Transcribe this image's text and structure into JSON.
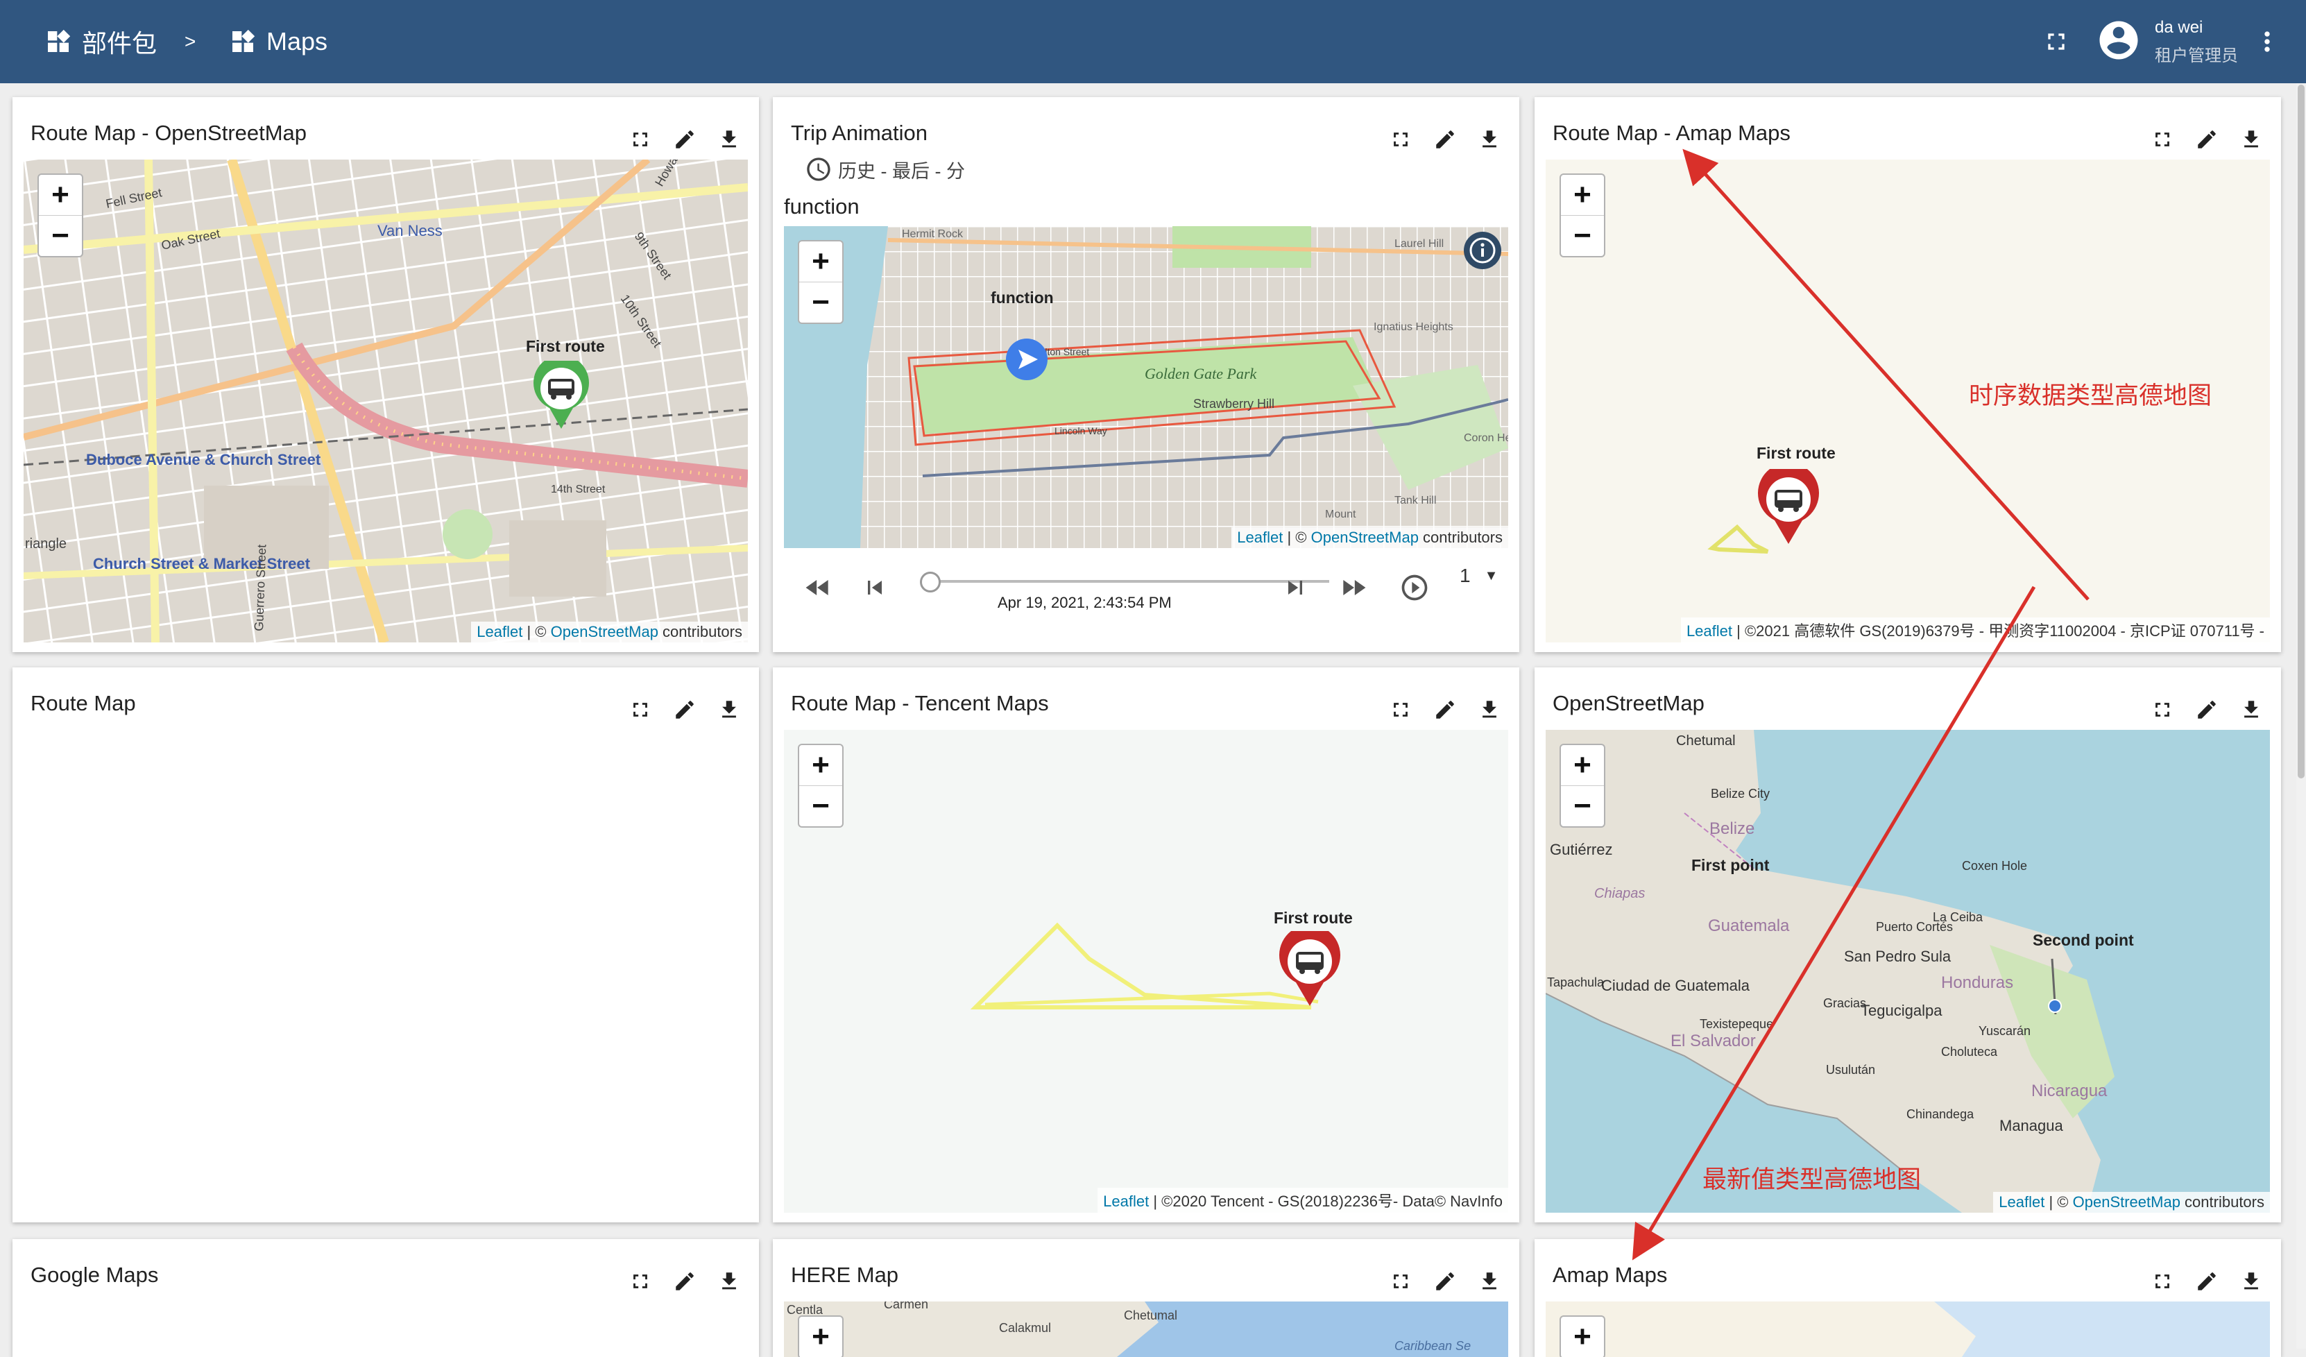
{
  "header": {
    "breadcrumb_parent": "部件包",
    "separator": ">",
    "breadcrumb_current": "Maps",
    "user_name": "da wei",
    "user_role": "租户管理员"
  },
  "widgets": {
    "w1": {
      "title": "Route Map - OpenStreetMap",
      "marker_label": "First route",
      "attr_link1": "Leaflet",
      "attr_mid": " | © ",
      "attr_link2": "OpenStreetMap",
      "attr_tail": " contributors",
      "map_text": {
        "fell": "Fell Street",
        "vanness": "Van Ness",
        "oak": "Oak Street",
        "duboce": "Duboce Avenue & Church Street",
        "church": "Church Street & Market Street",
        "howard": "Howard",
        "ninth": "9th Street",
        "tenth": "10th Street",
        "fourteenth": "14th Street",
        "guerrero": "Guerrero Street",
        "triangle": "riangle"
      }
    },
    "w2": {
      "title": "Trip Animation",
      "subtitle": "历史 - 最后 - 分",
      "label": "function",
      "marker_label": "function",
      "time": "Apr 19, 2021, 2:43:54 PM",
      "speed": "1",
      "attr_link1": "Leaflet",
      "attr_mid": " | © ",
      "attr_link2": "OpenStreetMap",
      "attr_tail": " contributors",
      "map_text": {
        "golden_gate": "Golden Gate Park",
        "strawberry": "Strawberry Hill",
        "lincoln": "Lincoln Way",
        "fulton": "Fulton Street",
        "hermit": "Hermit Rock",
        "laurel": "Laurel Hill",
        "ignatius": "Ignatius Heights",
        "tank": "Tank Hill",
        "mount": "Mount",
        "coron": "Coron Height"
      }
    },
    "w3": {
      "title": "Route Map - Amap Maps",
      "marker_label": "First route",
      "attr_link1": "Leaflet",
      "attr_text": " | ©2021 高德软件 GS(2019)6379号 - 甲测资字11002004 - 京ICP证 070711号 -"
    },
    "w4": {
      "title": "Route Map"
    },
    "w5": {
      "title": "Route Map - Tencent Maps",
      "marker_label": "First route",
      "attr_link1": "Leaflet",
      "attr_text": " | ©2020 Tencent - GS(2018)2236号- Data© NavInfo"
    },
    "w6": {
      "title": "OpenStreetMap",
      "first_point": "First point",
      "second_point": "Second point",
      "attr_link1": "Leaflet",
      "attr_mid": " | © ",
      "attr_link2": "OpenStreetMap",
      "attr_tail": " contributors",
      "map_text": {
        "chetumal": "Chetumal",
        "belize_city": "Belize City",
        "belize": "Belize",
        "gutierrez": "Gutiérrez",
        "chiapas": "Chiapas",
        "guatemala": "Guatemala",
        "tapachula": "Tapachula",
        "ciudad": "Ciudad de Guatemala",
        "el_salvador": "El Salvador",
        "san_pedro": "San Pedro Sula",
        "honduras": "Honduras",
        "tegucigalpa": "Tegucigalpa",
        "nicaragua": "Nicaragua",
        "managua": "Managua",
        "puerto": "Puerto Cortés",
        "la_ceiba": "La Ceiba",
        "coxen": "Coxen Hole",
        "gracias": "Gracias",
        "choluteca": "Choluteca",
        "usulutan": "Usulután",
        "chinandega": "Chinandega",
        "yuscaran": "Yuscarán",
        "texistepeque": "Texistepeque"
      }
    },
    "w7": {
      "title": "Google Maps"
    },
    "w8": {
      "title": "HERE Map",
      "map_text": {
        "carmen": "Carmen",
        "calakmul": "Calakmul",
        "chetumal": "Chetumal",
        "caribbean": "Caribbean Se",
        "centla": "Centla"
      }
    },
    "w9": {
      "title": "Amap Maps"
    }
  },
  "annotations": {
    "a1": "时序数据类型高德地图",
    "a2": "最新值类型高德地图"
  },
  "colors": {
    "header": "#305680",
    "annotation": "#d9302a",
    "route_yellow": "#eaea70",
    "marker_red": "#c62828",
    "marker_green": "#4caf50"
  }
}
